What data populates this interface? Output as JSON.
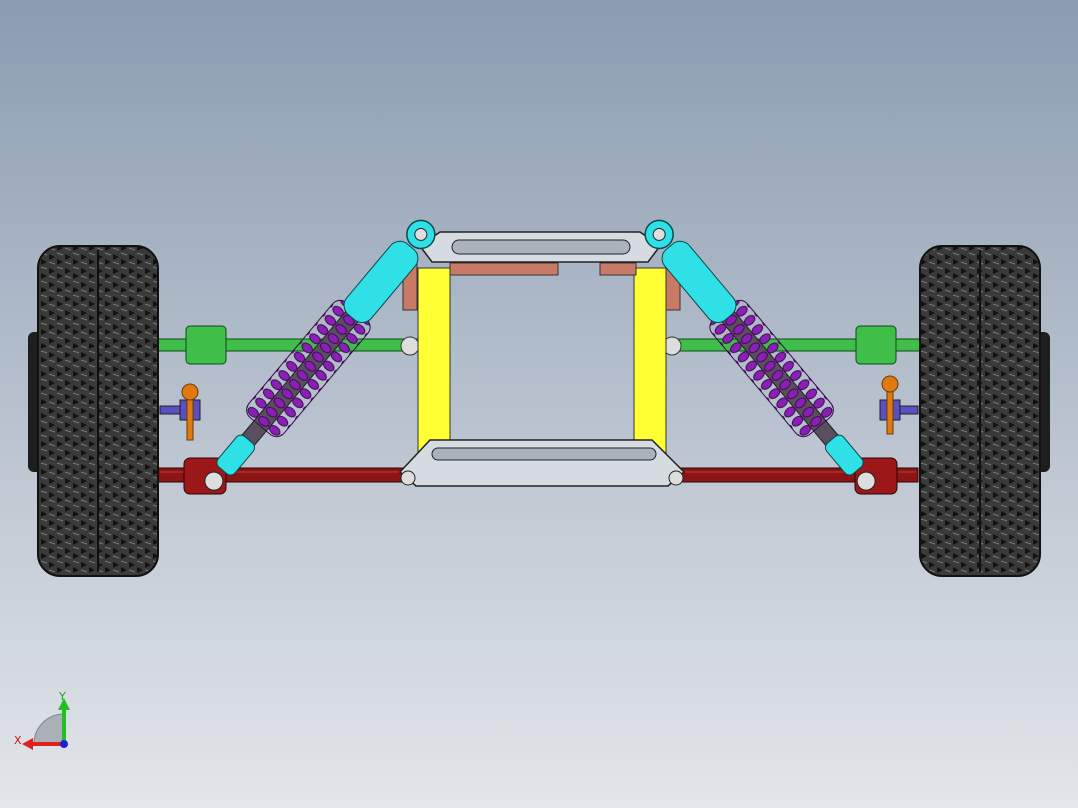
{
  "viewport": {
    "background_top": "#8b9cb1",
    "background_bottom": "#e3e6ea"
  },
  "model": {
    "components": [
      "tire-left",
      "tire-right",
      "coilover-left",
      "coilover-right",
      "upper-crossmember",
      "lower-crossmember",
      "frame-rail-left",
      "frame-rail-right",
      "lower-control-arm",
      "tie-rod",
      "sway-bar-link-left",
      "sway-bar-link-right"
    ],
    "colors": {
      "tire": "#2c2c2c",
      "shock_body": "#2fe0e6",
      "spring": "#8a1fb3",
      "shock_rod": "#5a4f5e",
      "frame": "#ffff33",
      "crossmember": "#d6dbe2",
      "lower_arm": "#8c1414",
      "tie_rod": "#3fbf4a",
      "bracket": "#c97a66",
      "link_ball": "#e07a10",
      "link_clamp": "#5a4fc0"
    }
  },
  "triad": {
    "x_label": "X",
    "y_label": "Y",
    "x_color": "#e02020",
    "y_color": "#20c020",
    "z_color": "#2020d0"
  }
}
